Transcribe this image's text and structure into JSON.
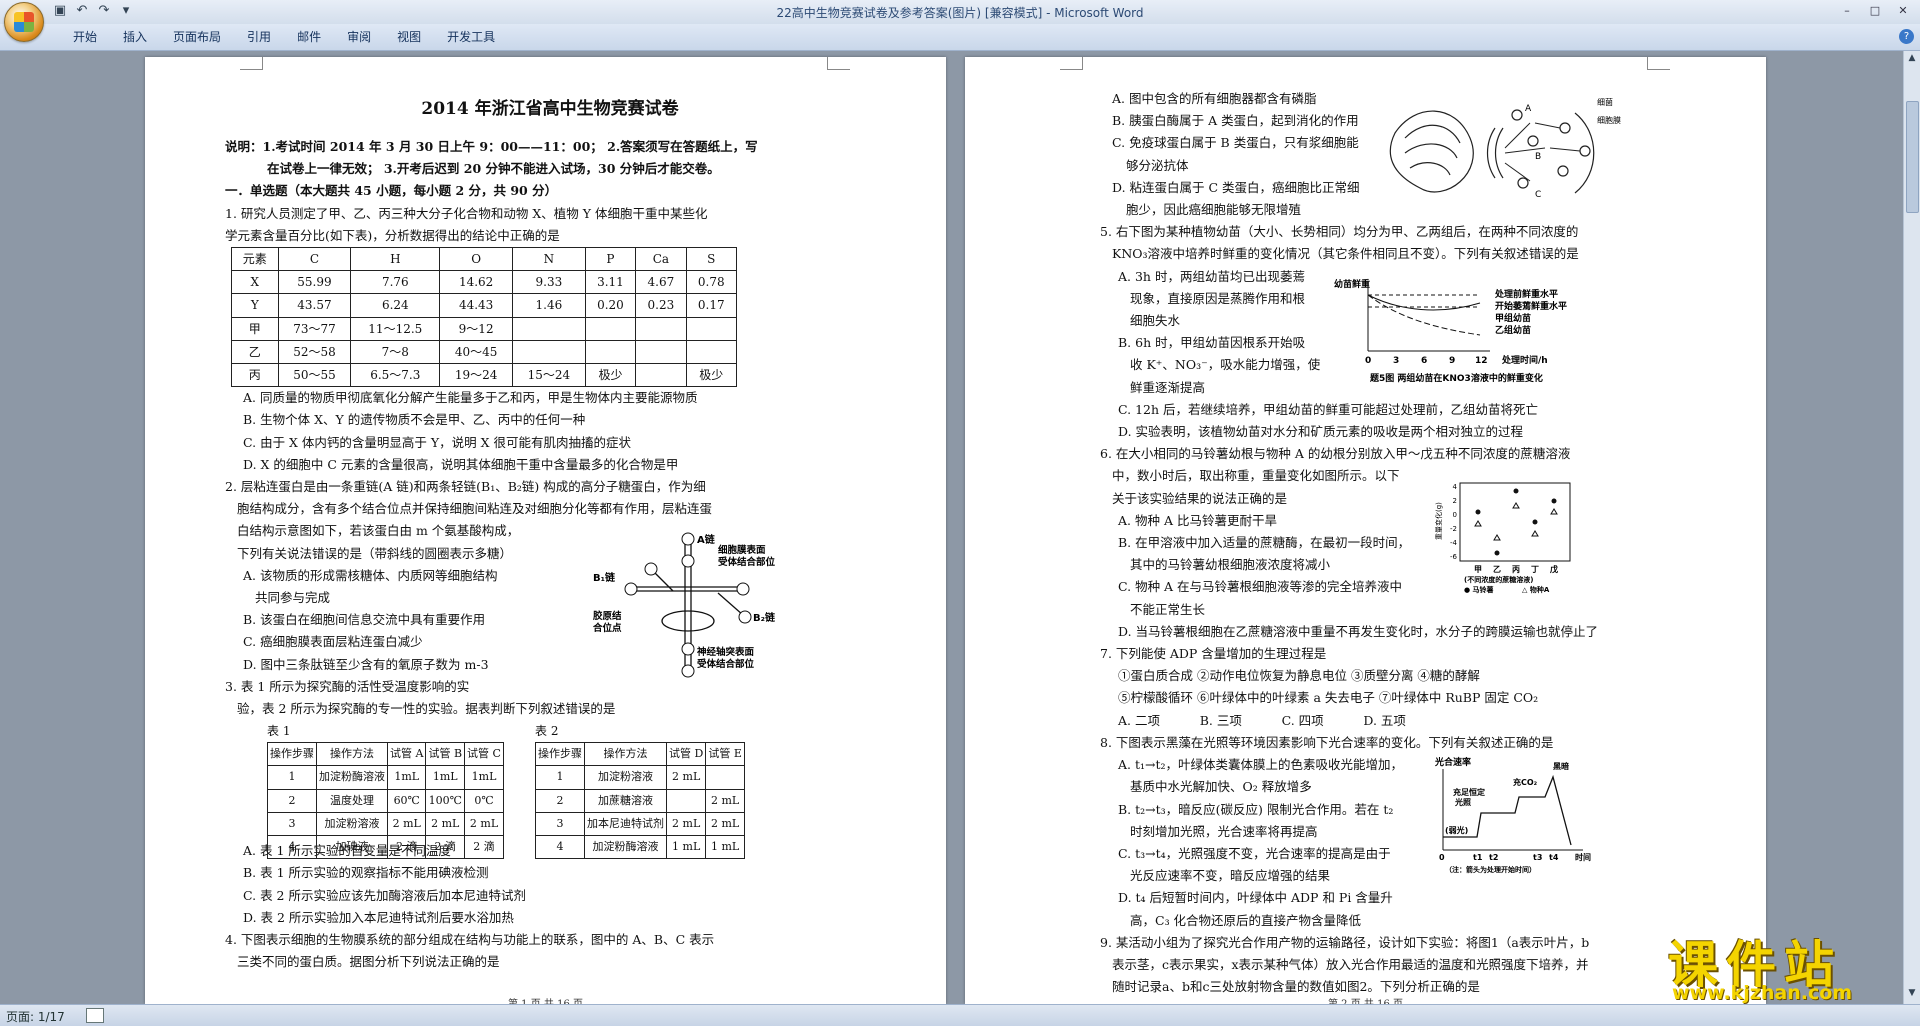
{
  "window": {
    "title": "22高中生物竞赛试卷及参考答案(图片) [兼容模式] - Microsoft Word",
    "controls": [
      "–",
      "□",
      "✕"
    ]
  },
  "qat": [
    "save-icon",
    "undo-icon",
    "redo-icon",
    "customize-icon"
  ],
  "ribbon": {
    "tabs": [
      "开始",
      "插入",
      "页面布局",
      "引用",
      "邮件",
      "审阅",
      "视图",
      "开发工具"
    ],
    "help": "?"
  },
  "status": {
    "page": "页面: 1/17"
  },
  "watermark": {
    "text": "课件站",
    "url": "www.kjzhan.com"
  },
  "left": {
    "title": "2014 年浙江省高中生物竞赛试卷",
    "note1": "说明：1.考试时间 2014 年 3 月 30 日上午 9：00——11：00；  2.答案须写在答题纸上，写",
    "note2": "在试卷上一律无效；  3.开考后迟到 20 分钟不能进入试场，30 分钟后才能交卷。",
    "sec1": "一．单选题（本大题共 45 小题，每小题 2 分，共 90 分）",
    "q1a": "1. 研究人员测定了甲、乙、丙三种大分子化合物和动物 X、植物 Y 体细胞干重中某些化",
    "q1b": "学元素含量百分比(如下表)，分析数据得出的结论中正确的是",
    "table1": {
      "header": [
        "元素",
        "C",
        "H",
        "O",
        "N",
        "P",
        "Ca",
        "S"
      ],
      "rows": [
        [
          "X",
          "55.99",
          "7.76",
          "14.62",
          "9.33",
          "3.11",
          "4.67",
          "0.78"
        ],
        [
          "Y",
          "43.57",
          "6.24",
          "44.43",
          "1.46",
          "0.20",
          "0.23",
          "0.17"
        ],
        [
          "甲",
          "73～77",
          "11～12.5",
          "9～12",
          "",
          "",
          "",
          ""
        ],
        [
          "乙",
          "52～58",
          "7～8",
          "40～45",
          "",
          "",
          "",
          ""
        ],
        [
          "丙",
          "50～55",
          "6.5～7.3",
          "19～24",
          "15～24",
          "极少",
          "",
          "极少"
        ]
      ]
    },
    "q1A": "A. 同质量的物质甲彻底氧化分解产生能量多于乙和丙，甲是生物体内主要能源物质",
    "q1B": "B. 生物个体 X、Y 的遗传物质不会是甲、乙、丙中的任何一种",
    "q1C": "C. 由于 X 体内钙的含量明显高于 Y，说明 X 很可能有肌肉抽搐的症状",
    "q1D": "D. X 的细胞中 C 元素的含量很高，说明其体细胞干重中含量最多的化合物是甲",
    "q2a": "2. 层粘连蛋白是由一条重链(A 链)和两条轻链(B₁、B₂链) 构成的高分子糖蛋白，作为细",
    "q2b": "胞结构成分，含有多个结合位点并保持细胞间粘连及对细胞分化等都有作用，层粘连蛋",
    "q2c": "白结构示意图如下，若该蛋白由 m 个氨基酸构成，",
    "q2d": "下列有关说法错误的是（带斜线的圆圈表示多糖）",
    "q2A1": "A. 该物质的形成需核糖体、内质网等细胞结构",
    "q2A2": "共同参与完成",
    "q2B": "B. 该蛋白在细胞间信息交流中具有重要作用",
    "q2C": "C. 癌细胞膜表面层粘连蛋白减少",
    "q2D": "D. 图中三条肽链至少含有的氧原子数为 m-3",
    "fig2": {
      "a": "A链",
      "b1": "B₁链",
      "b2": "B₂链",
      "s1": "细胞膜表面",
      "s2": "受体结合部位",
      "c1": "胶原结",
      "c2": "合位点",
      "n1": "神经轴突表面",
      "n2": "受体结合部位"
    },
    "q3a": "3. 表 1 所示为探究酶的活性受温度影响的实",
    "q3b": "验，表 2 所示为探究酶的专一性的实验。据表判断下列叙述错误的是",
    "tbl1_label": "表 1",
    "tbl2_label": "表 2",
    "table2": {
      "header": [
        "操作步骤",
        "操作方法",
        "试管 A",
        "试管 B",
        "试管 C"
      ],
      "rows": [
        [
          "1",
          "加淀粉酶溶液",
          "1mL",
          "1mL",
          "1mL"
        ],
        [
          "2",
          "温度处理",
          "60℃",
          "100℃",
          "0℃"
        ],
        [
          "3",
          "加淀粉溶液",
          "2 mL",
          "2 mL",
          "2 mL"
        ],
        [
          "4",
          "加碘液",
          "2 滴",
          "2 滴",
          "2 滴"
        ]
      ]
    },
    "table3": {
      "header": [
        "操作步骤",
        "操作方法",
        "试管 D",
        "试管 E"
      ],
      "rows": [
        [
          "1",
          "加淀粉溶液",
          "2 mL",
          ""
        ],
        [
          "2",
          "加蔗糖溶液",
          "",
          "2 mL"
        ],
        [
          "3",
          "加本尼迪特试剂",
          "2 mL",
          "2 mL"
        ],
        [
          "4",
          "加淀粉酶溶液",
          "1 mL",
          "1 mL"
        ]
      ]
    },
    "q3A": "A. 表 1 所示实验的自变量是不同温度",
    "q3B": "B. 表 1 所示实验的观察指标不能用碘液检测",
    "q3C": "C. 表 2 所示实验应该先加酶溶液后加本尼迪特试剂",
    "q3D": "D. 表 2 所示实验加入本尼迪特试剂后要水浴加热",
    "q4a": "4. 下图表示细胞的生物膜系统的部分组成在结构与功能上的联系，图中的 A、B、C 表示",
    "q4b": "三类不同的蛋白质。据图分析下列说法正确的是",
    "footer": "第 1 页 共 16 页"
  },
  "right": {
    "q4A": "A. 图中包含的所有细胞器都含有磷脂",
    "q4B": "B. 胰蛋白酶属于 A 类蛋白，起到消化的作用",
    "q4C1": "C. 免疫球蛋白属于 B 类蛋白，只有浆细胞能",
    "q4C2": "够分泌抗体",
    "q4D1": "D. 粘连蛋白属于 C 类蛋白，癌细胞比正常细",
    "q4D2": "胞少，因此癌细胞能够无限增殖",
    "fig4": {
      "l1": "细菌",
      "l2": "细胞膜",
      "a": "A",
      "b": "B",
      "c": "C"
    },
    "q5a": "5. 右下图为某种植物幼苗（大小、长势相同）均分为甲、乙两组后，在两种不同浓度的",
    "q5b": "KNO₃溶液中培养时鲜重的变化情况（其它条件相同且不变）。下列有关叙述错误的是",
    "q5A1": "A. 3h 时，两组幼苗均已出现萎蔫",
    "q5A2": "现象，直接原因是蒸腾作用和根",
    "q5A3": "细胞失水",
    "q5B1": "B. 6h 时，甲组幼苗因根系开始吸",
    "q5B2": "收 K⁺、NO₃⁻，吸水能力增强，使",
    "q5B3": "鲜重逐渐提高",
    "q5C": "C. 12h 后，若继续培养，甲组幼苗的鲜重可能超过处理前，乙组幼苗将死亡",
    "q5D": "D. 实验表明，该植物幼苗对水分和矿质元素的吸收是两个相对独立的过程",
    "fig5": {
      "ylabel": "幼苗鲜重",
      "l1": "处理前鲜重水平",
      "l2": "开始萎蔫鲜重水平",
      "l3": "甲组幼苗",
      "l4": "乙组幼苗",
      "xticks": [
        "0",
        "3",
        "6",
        "9",
        "12"
      ],
      "xlabel": "处理时间/h",
      "caption": "题5图  两组幼苗在KNO3溶液中的鲜重变化"
    },
    "q6a": "6. 在大小相同的马铃薯幼根与物种 A 的幼根分别放入甲～戊五种不同浓度的蔗糖溶液",
    "q6b": "中，数小时后，取出称重，重量变化如图所示。以下",
    "q6c": "关于该实验结果的说法正确的是",
    "q6A": "A. 物种 A 比马铃薯更耐干旱",
    "q6B1": "B. 在甲溶液中加入适量的蔗糖酶，在最初一段时间，",
    "q6B2": "其中的马铃薯幼根细胞液浓度将减小",
    "q6C1": "C. 物种 A 在与马铃薯根细胞液等渗的完全培养液中",
    "q6C2": "不能正常生长",
    "q6D": "D. 当马铃薯根细胞在乙蔗糖溶液中重量不再发生变化时，水分子的跨膜运输也就停止了",
    "fig6": {
      "ylabel": "重量变化(g)",
      "yticks": [
        "4",
        "3",
        "2",
        "1",
        "0",
        "-1",
        "-2",
        "-3",
        "-4",
        "-5",
        "-6"
      ],
      "cats": [
        "甲",
        "乙",
        "丙",
        "丁",
        "戊"
      ],
      "sub": "(不同浓度的蔗糖溶液)",
      "legend1": "● 马铃薯",
      "legend2": "△ 物种A"
    },
    "q7": "7. 下列能使 ADP 含量增加的生理过程是",
    "q7o1": "①蛋白质合成       ②动作电位恢复为静息电位       ③质壁分离        ④糖的酵解",
    "q7o2": "⑤柠檬酸循环       ⑥叶绿体中的叶绿素 a 失去电子       ⑦叶绿体中 RuBP 固定 CO₂",
    "q7opts": "A. 二项          B. 三项          C. 四项          D. 五项",
    "q8": "8. 下图表示黑藻在光照等环境因素影响下光合速率的变化。下列有关叙述正确的是",
    "q8A1": "A. t₁→t₂，叶绿体类囊体膜上的色素吸收光能增加，",
    "q8A2": "基质中水光解加快、O₂ 释放增多",
    "q8B1": "B. t₂→t₃，暗反应(碳反应) 限制光合作用。若在 t₂",
    "q8B2": "时刻增加光照，光合速率将再提高",
    "q8C1": "C. t₃→t₄，光照强度不变，光合速率的提高是由于",
    "q8C2": "光反应速率不变，暗反应增强的结果",
    "q8D1": "D. t₄ 后短暂时间内，叶绿体中 ADP 和 Pi 含量升",
    "q8D2": "高，C₃ 化合物还原后的直接产物含量降低",
    "fig8": {
      "ylabel": "光合速率",
      "dark": "黑暗",
      "co2": "充CO₂",
      "sat1": "充足恒定",
      "sat2": "光照",
      "weak": "(弱光)",
      "xticks": [
        "0",
        "t1",
        "t2",
        "t3",
        "t4"
      ],
      "xlabel": "时间",
      "note": "（注：箭头为处理开始时间）"
    },
    "q9a": "9. 某活动小组为了探究光合作用产物的运输路径，设计如下实验：将图1（a表示叶片，b",
    "q9b": "表示茎，c表示果实，x表示某种气体）放入光合作用最适的温度和光照强度下培养，并",
    "q9c": "随时记录a、b和c三处放射物含量的数值如图2。下列分析正确的是",
    "footer": "第 2 页 共 16 页"
  }
}
